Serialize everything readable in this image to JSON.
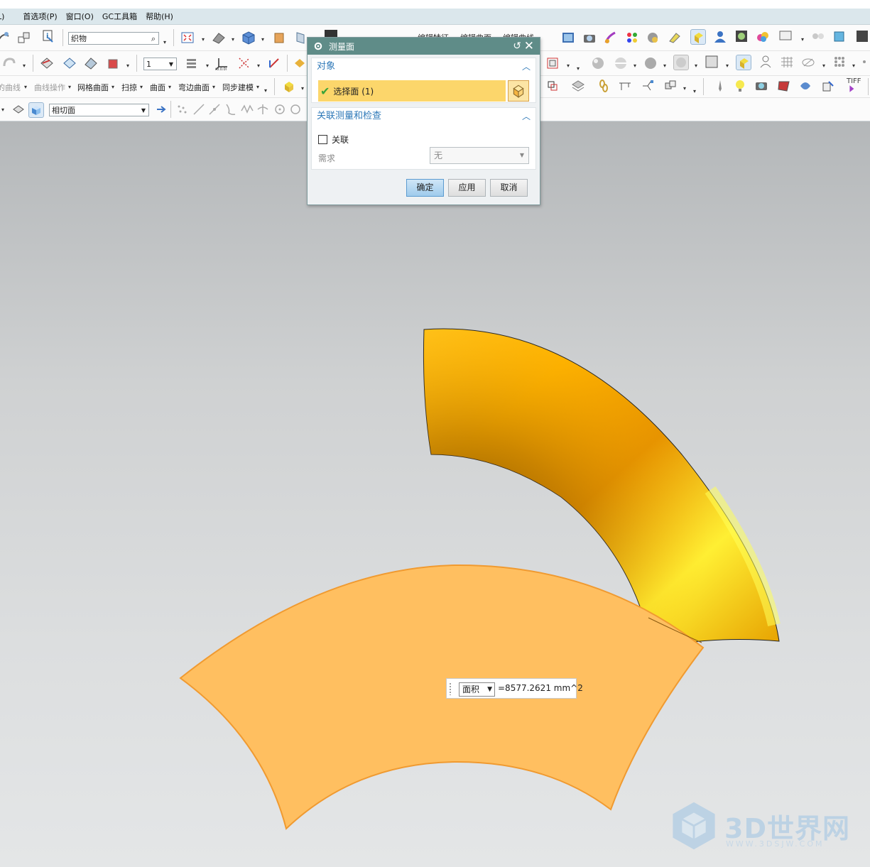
{
  "menu": {
    "items": [
      "L)",
      "首选项(P)",
      "窗口(O)",
      "GC工具箱",
      "帮助(H)"
    ]
  },
  "toolbar": {
    "search_value": "织物",
    "layer_value": "1",
    "curve_menus": [
      "的曲线",
      "曲线操作",
      "网格曲面",
      "扫掠",
      "曲面",
      "弯边曲面",
      "同步建模"
    ],
    "edit_labels": [
      "编辑特征",
      "编辑曲面",
      "编辑曲线"
    ],
    "filter_value": "相切面",
    "tiff_label": "TIFF"
  },
  "dialog": {
    "title": "测量面",
    "group_object": "对象",
    "select_label": "选择面 (1)",
    "group_assoc": "关联测量和检查",
    "assoc_label": "关联",
    "assoc_checked": false,
    "require_label": "需求",
    "require_value": "无",
    "buttons": {
      "ok": "确定",
      "apply": "应用",
      "cancel": "取消"
    }
  },
  "measurement": {
    "type": "面积",
    "value": "=8577.2621 mm^2"
  },
  "watermark": {
    "text": "3D世界网",
    "sub": "WWW.3DSJW.COM"
  },
  "colors": {
    "title_bar": "#5f8c88",
    "selection_highlight": "#fcd66b",
    "face_fill": "#ffbf60",
    "pipe_color": "#ffb800"
  }
}
